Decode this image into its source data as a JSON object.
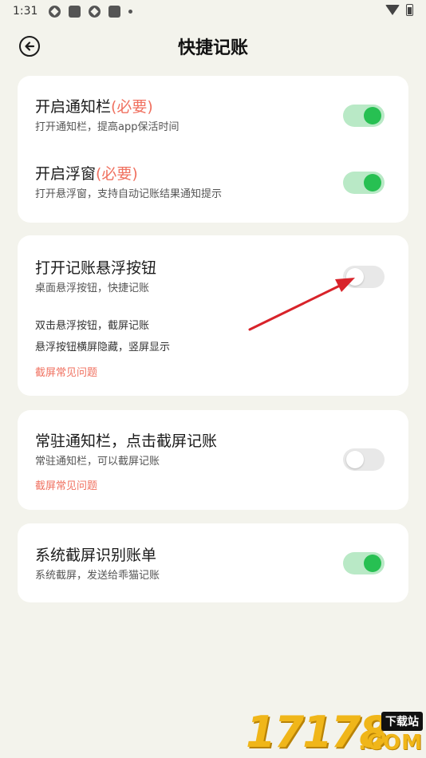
{
  "status_bar": {
    "time": "1:31"
  },
  "header": {
    "title": "快捷记账"
  },
  "cards": {
    "notify_bar": {
      "title": "开启通知栏",
      "required": "(必要)",
      "subtitle": "打开通知栏，提高app保活时间",
      "enabled": true
    },
    "float_window": {
      "title": "开启浮窗",
      "required": "(必要)",
      "subtitle": "打开悬浮窗，支持自动记账结果通知提示",
      "enabled": true
    },
    "float_button": {
      "title": "打开记账悬浮按钮",
      "subtitle": "桌面悬浮按钮，快捷记账",
      "note1": "双击悬浮按钮，截屏记账",
      "note2": "悬浮按钮横屏隐藏，竖屏显示",
      "faq_link": "截屏常见问题",
      "enabled": false
    },
    "resident_bar": {
      "title": "常驻通知栏，点击截屏记账",
      "subtitle": "常驻通知栏，可以截屏记账",
      "faq_link": "截屏常见问题",
      "enabled": false
    },
    "system_screenshot": {
      "title": "系统截屏识别账单",
      "subtitle": "系统截屏，发送给乖猫记账",
      "enabled": true
    }
  },
  "watermark": {
    "digits": "17178",
    "badge": "下载站",
    "suffix": ".COM"
  },
  "colors": {
    "accent_on": "#27c052",
    "track_on": "#b9e9c6",
    "required": "#f07160",
    "arrow": "#d8232a"
  }
}
